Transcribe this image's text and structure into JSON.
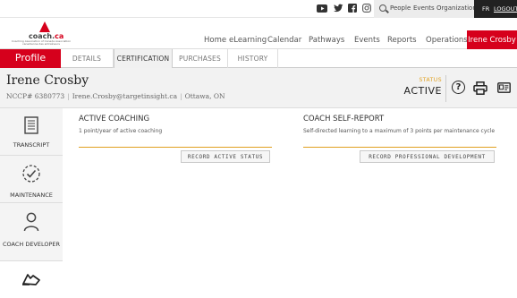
{
  "topbar": {
    "social_icons": [
      "youtube-icon",
      "twitter-icon",
      "facebook-icon",
      "instagram-icon"
    ],
    "search": {
      "people": "People",
      "events": "Events",
      "organizations": "Organizations"
    },
    "lang": {
      "fr": "FR",
      "logout": "LOGOUT"
    }
  },
  "logo": {
    "brand_main": "coach.",
    "brand_ca": "ca",
    "tagline": "Coaching Association of Canada Association canadienne des entraîneurs"
  },
  "nav": {
    "items": [
      "Home",
      "eLearning",
      "Calendar",
      "Pathways",
      "Events",
      "Reports",
      "Operations"
    ],
    "user": "Irene Crosby"
  },
  "tabs": {
    "profile_label": "Profile",
    "items": [
      "DETAILS",
      "CERTIFICATION",
      "PURCHASES",
      "HISTORY"
    ],
    "active": "CERTIFICATION"
  },
  "header": {
    "name": "Irene Crosby",
    "nccp": "NCCP# 6380773",
    "email": "Irene.Crosby@targetinsight.ca",
    "location": "Ottawa, ON",
    "status_label": "STATUS",
    "status_value": "ACTIVE"
  },
  "sidebar": {
    "items": [
      {
        "label": "TRANSCRIPT",
        "icon": "transcript-icon"
      },
      {
        "label": "MAINTENANCE",
        "icon": "maintenance-icon"
      },
      {
        "label": "COACH DEVELOPER",
        "icon": "coach-developer-icon"
      },
      {
        "label": "",
        "icon": "handshake-icon"
      }
    ]
  },
  "content": {
    "active_coaching": {
      "title": "ACTIVE COACHING",
      "description": "1 point/year of active coaching",
      "button": "RECORD ACTIVE STATUS"
    },
    "self_report": {
      "title": "COACH SELF-REPORT",
      "description": "Self-directed learning to a maximum of 3 points per maintenance cycle",
      "button": "RECORD PROFESSIONAL DEVELOPMENT"
    }
  },
  "colors": {
    "brand_red": "#d6001c",
    "accent_gold": "#e0a020"
  }
}
